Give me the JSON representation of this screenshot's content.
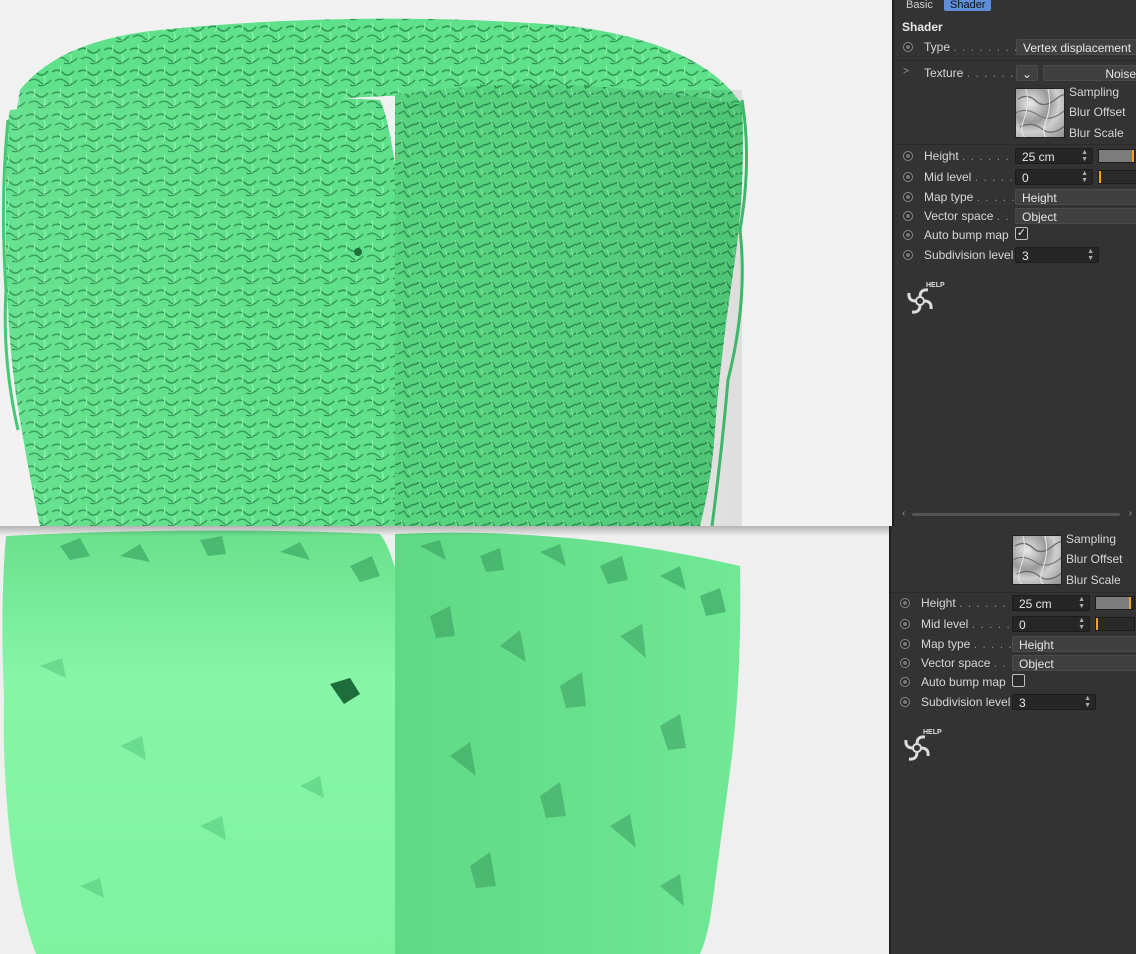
{
  "tabs": {
    "basic": "Basic",
    "shader": "Shader"
  },
  "section_title": "Shader",
  "type": {
    "label": "Type",
    "value": "Vertex displacement"
  },
  "texture": {
    "label": "Texture",
    "value": "Noise",
    "dropdown_icon": "chevron-down-icon",
    "expand_icon": "chevron-right-icon"
  },
  "sampling": {
    "label": "Sampling"
  },
  "blur_offset": {
    "label": "Blur Offset"
  },
  "blur_scale": {
    "label": "Blur Scale"
  },
  "top": {
    "height": {
      "label": "Height",
      "value": "25 cm",
      "slider_fraction": 0.92
    },
    "mid_level": {
      "label": "Mid level",
      "value": "0",
      "slider_fraction": 0.0
    },
    "map_type": {
      "label": "Map type",
      "value": "Height"
    },
    "vector_space": {
      "label": "Vector space",
      "value": "Object"
    },
    "auto_bump_map": {
      "label": "Auto bump map",
      "checked": true,
      "check_glyph": "✓"
    },
    "subdivision_level": {
      "label": "Subdivision level",
      "value": "3"
    }
  },
  "bottom": {
    "height": {
      "label": "Height",
      "value": "25 cm",
      "slider_fraction": 0.92
    },
    "mid_level": {
      "label": "Mid level",
      "value": "0",
      "slider_fraction": 0.0
    },
    "map_type": {
      "label": "Map type",
      "value": "Height"
    },
    "vector_space": {
      "label": "Vector space",
      "value": "Object"
    },
    "auto_bump_map": {
      "label": "Auto bump map",
      "checked": false,
      "check_glyph": ""
    },
    "subdivision_level": {
      "label": "Subdivision level",
      "value": "3"
    }
  },
  "help_label": "HELP",
  "colors": {
    "mesh_top": "#5fe08a",
    "mesh_bottom": "#7ff2a0",
    "viewport_bg": "#f1f1f1",
    "panel_bg": "#333333",
    "tab_active": "#5d8fd8",
    "slider_marker": "#f2a417"
  }
}
